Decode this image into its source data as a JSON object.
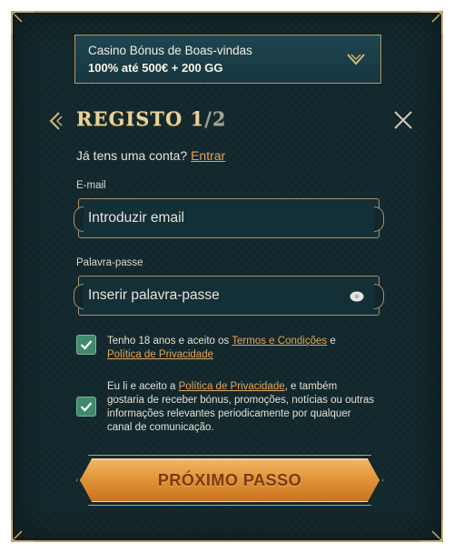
{
  "bonus": {
    "line1": "Casino Bónus de Boas-vindas",
    "line2": "100% até 500€ + 200 GG"
  },
  "header": {
    "title_prefix": "REGISTO 1",
    "title_total": "/2"
  },
  "login_prompt": {
    "text": "Já tens uma conta?",
    "link": "Entrar"
  },
  "email": {
    "label": "E-mail",
    "placeholder": "Introduzir email"
  },
  "password": {
    "label": "Palavra-passe",
    "placeholder": "Inserir palavra-passe"
  },
  "terms": {
    "checked": true,
    "text_before": "Tenho 18 anos e aceito os",
    "link_terms": "Termos e Condições",
    "connector": "e",
    "link_privacy": "Política de Privacidade"
  },
  "marketing": {
    "checked": true,
    "text_before": "Eu li e aceito a",
    "link_privacy": "Política de Privacidade",
    "text_after": ", e também gostaria de receber bónus, promoções, notícias ou outras informações relevantes periodicamente por qualquer canal de comunicação."
  },
  "next_button": "PRÓXIMO PASSO",
  "icons": {
    "dropdown": "chevron-down-icon",
    "back": "chevron-left-icon",
    "close": "close-icon",
    "eye": "eye-icon",
    "check": "check-icon"
  },
  "colors": {
    "panel_bg": "#12272c",
    "gold_border": "#b59a6a",
    "link": "#e3a45a",
    "checkbox": "#3f8a6b",
    "button": "#e2963a"
  }
}
